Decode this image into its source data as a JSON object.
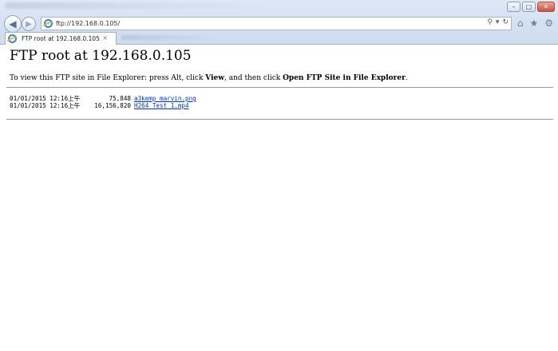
{
  "browser": {
    "address": "ftp://192.168.0.105/",
    "tab_title": "FTP root at 192.168.0.105",
    "tab_close": "×",
    "controls": {
      "minimize": "–",
      "maximize": "□",
      "close": "✕"
    }
  },
  "page": {
    "title": "FTP root at 192.168.0.105",
    "instructions": {
      "prefix": "To view this FTP site in File Explorer: press Alt, click ",
      "view": "View",
      "middle": ", and then click ",
      "open": "Open FTP Site in File Explorer",
      "suffix": "."
    },
    "files": [
      {
        "date": "01/01/2015 12:16上午",
        "size": "75,848",
        "name": "a3kemp_marvin.png"
      },
      {
        "date": "01/01/2015 12:16上午",
        "size": "16,156,820",
        "name": "H264_Test_1.mp4"
      }
    ]
  },
  "icons": {
    "back": "back-arrow-icon",
    "forward": "forward-arrow-icon",
    "search": "search-icon",
    "refresh": "refresh-icon",
    "home": "home-icon",
    "favorites": "star-icon",
    "tools": "gear-icon"
  }
}
